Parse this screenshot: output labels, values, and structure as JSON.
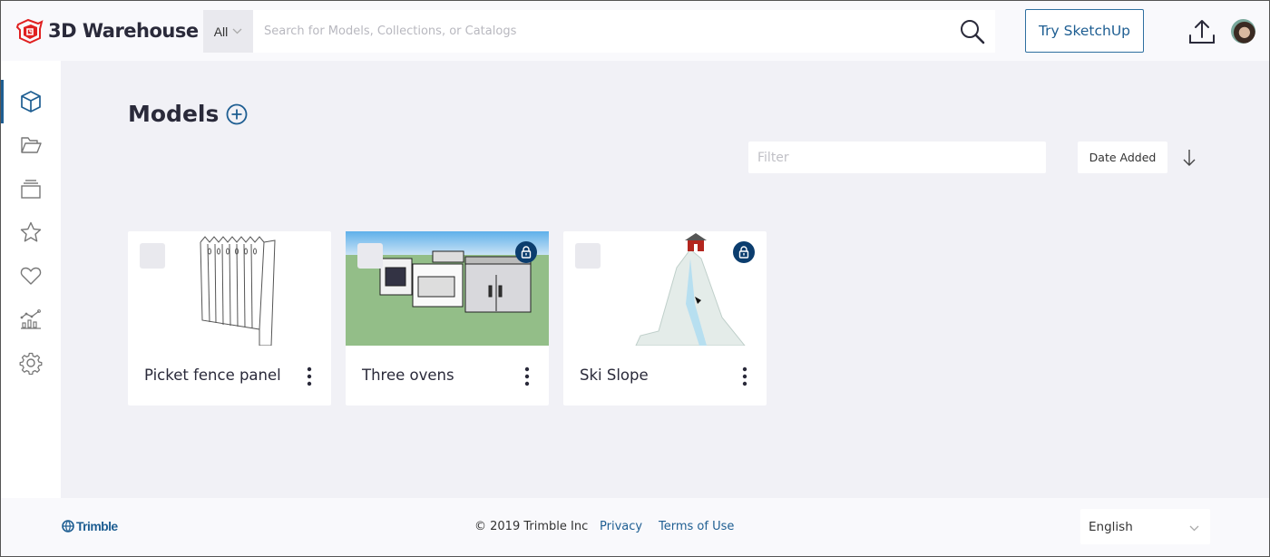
{
  "header": {
    "brand": "3D Warehouse",
    "search_scope": "All",
    "search_placeholder": "Search for Models, Collections, or Catalogs",
    "search_value": "",
    "try_button": "Try SketchUp",
    "icons": {
      "logo": "3d-warehouse-logo-icon",
      "search": "magnifier-icon",
      "upload": "upload-icon",
      "avatar": "user-avatar"
    }
  },
  "sidebar": {
    "items": [
      {
        "name": "models",
        "icon": "cube-icon",
        "active": true
      },
      {
        "name": "collections",
        "icon": "folder-icon",
        "active": false
      },
      {
        "name": "catalogs",
        "icon": "stack-icon",
        "active": false
      },
      {
        "name": "favorites",
        "icon": "star-icon",
        "active": false
      },
      {
        "name": "likes",
        "icon": "heart-icon",
        "active": false
      },
      {
        "name": "analytics",
        "icon": "chart-icon",
        "active": false
      },
      {
        "name": "settings",
        "icon": "gear-icon",
        "active": false
      }
    ]
  },
  "main": {
    "title": "Models",
    "filter_placeholder": "Filter",
    "filter_value": "",
    "sort_label": "Date Added",
    "sort_direction": "descending",
    "cards": [
      {
        "name": "Picket fence panel",
        "locked": false,
        "thumbnail": "picket fence panel drawing"
      },
      {
        "name": "Three ovens",
        "locked": true,
        "thumbnail": "three ovens on green ground"
      },
      {
        "name": "Ski Slope",
        "locked": true,
        "thumbnail": "snowy mountain with red hut"
      }
    ]
  },
  "footer": {
    "brand": "Trimble",
    "copyright": "© 2019 Trimble Inc",
    "links": [
      "Privacy",
      "Terms of Use"
    ],
    "language": "English"
  },
  "colors": {
    "accent": "#1e5e92",
    "lock_badge": "#0b3d6e",
    "brand_red": "#e02020",
    "main_bg": "#f1f1f6",
    "header_bg": "#f9f9fc"
  }
}
